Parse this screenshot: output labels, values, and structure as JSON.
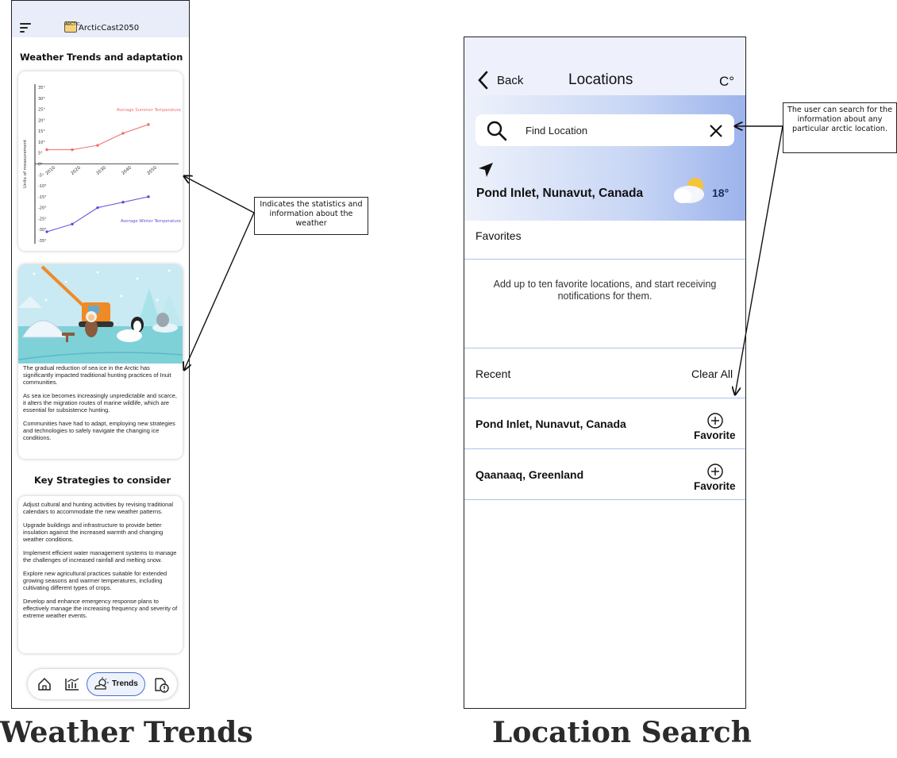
{
  "left": {
    "app_title": "ArcticCast2050",
    "brand_icon_text": "ARCTIC",
    "section_title": "Weather Trends and adaptation",
    "strategies_title": "Key Strategies to consider",
    "paragraphs": [
      "The gradual reduction of sea ice in the Arctic has significantly impacted traditional hunting practices of Inuit communities.",
      "As sea ice becomes increasingly unpredictable and scarce, it alters the migration routes of marine wildlife, which are essential for subsistence hunting.",
      "Communities have had to adapt, employing new strategies and technologies to safely navigate the changing ice conditions."
    ],
    "strategies": [
      "Adjust cultural and hunting activities by revising traditional calendars to accommodate the new weather patterns.",
      "Upgrade buildings and infrastructure to provide better insulation against the increased warmth and changing weather conditions.",
      "Implement efficient water management systems to manage the challenges of increased rainfall and melting snow.",
      "Explore new agricultural practices suitable for extended growing seasons and warmer temperatures, including cultivating different types of crops.",
      "Develop and enhance emergency response plans to effectively manage the increasing frequency and severity of extreme weather events."
    ],
    "nav": {
      "active_label": "Trends"
    },
    "caption": "Weather Trends"
  },
  "chart_data": {
    "type": "line",
    "ylabel": "Units of measurement",
    "x": [
      "2010",
      "2020",
      "2030",
      "2040",
      "2050"
    ],
    "y_ticks": [
      "35°",
      "30°",
      "25°",
      "20°",
      "15°",
      "10°",
      "5°",
      "0°",
      "-5°",
      "-10°",
      "-15°",
      "-20°",
      "-25°",
      "-30°",
      "-35°"
    ],
    "ylim": [
      -35,
      35
    ],
    "series": [
      {
        "name": "Average Summer Temperature",
        "color": "#f26b6b",
        "values": [
          6.5,
          6.5,
          8.5,
          14,
          18
        ]
      },
      {
        "name": "Average Winter Temperature",
        "color": "#5a4fd6",
        "values": [
          -31,
          -27.5,
          -20,
          -17.5,
          -15
        ]
      }
    ]
  },
  "right": {
    "back_label": "Back",
    "screen_title": "Locations",
    "unit_label": "C°",
    "search_placeholder": "Find Location",
    "current_location": "Pond Inlet, Nunavut, Canada",
    "current_temp": "18°",
    "favorites_label": "Favorites",
    "favorites_hint": "Add up to ten favorite locations, and start receiving notifications for them.",
    "recent_label": "Recent",
    "clear_all_label": "Clear All",
    "recent_items": [
      {
        "name": "Pond Inlet, Nunavut, Canada",
        "action": "Favorite"
      },
      {
        "name": "Qaanaaq, Greenland",
        "action": "Favorite"
      }
    ],
    "caption": "Location Search"
  },
  "annotations": {
    "weather_note": "Indicates the statistics and information about the weather",
    "search_note": "The user can search for the information about any particular arctic location."
  }
}
